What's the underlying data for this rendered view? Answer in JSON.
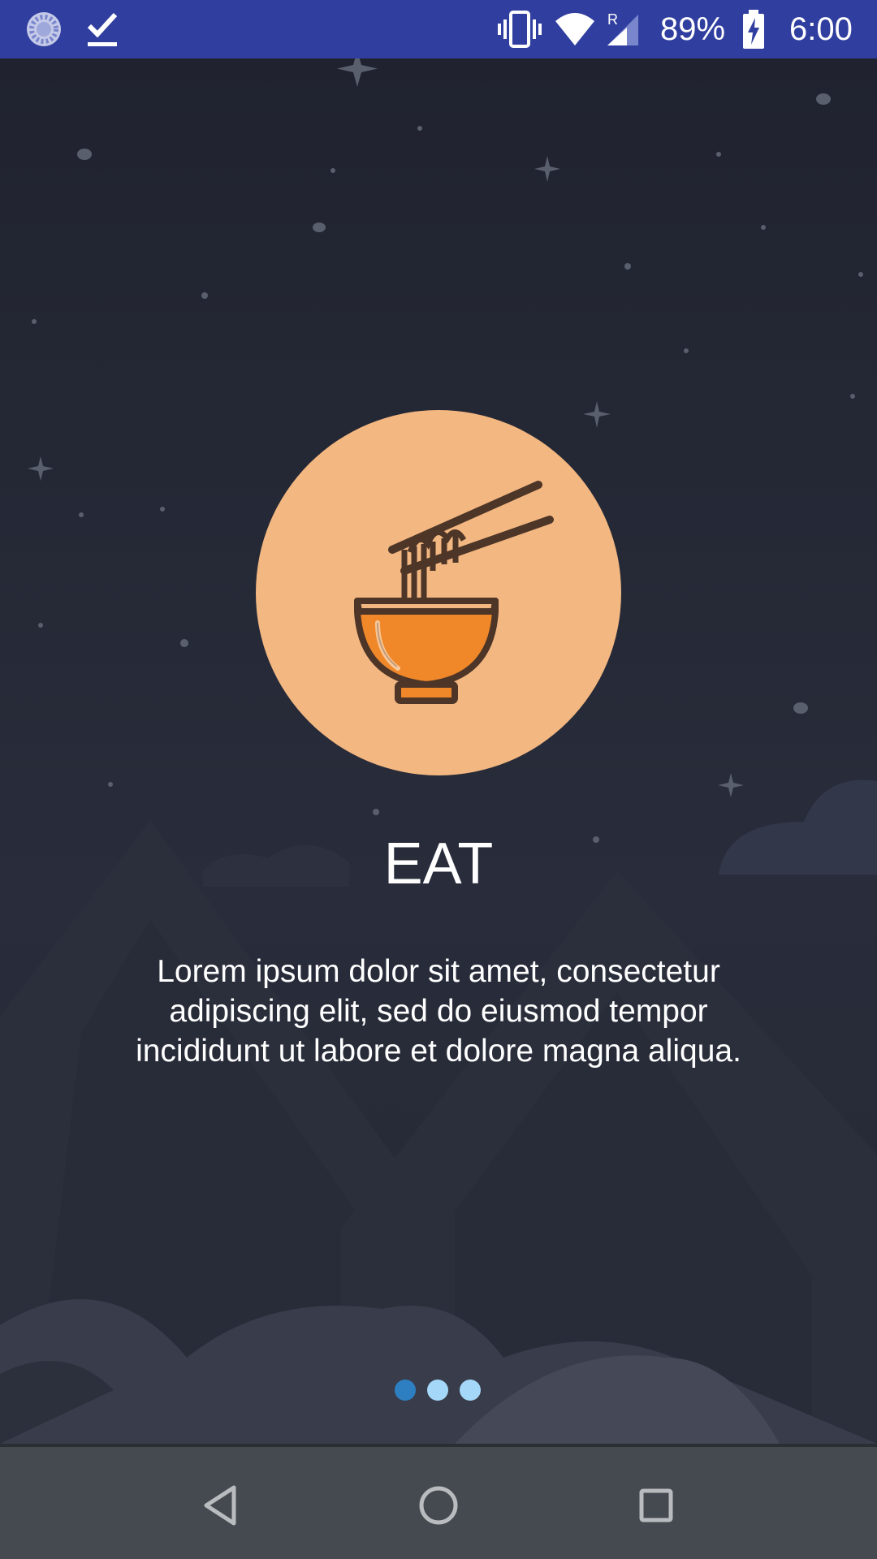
{
  "status_bar": {
    "battery_percent": "89%",
    "time": "6:00",
    "network_roaming_label": "R",
    "icons": [
      "sync-icon",
      "download-complete-icon",
      "vibrate-icon",
      "wifi-icon",
      "cell-signal-icon",
      "battery-charging-icon"
    ],
    "background_color": "#303f9f"
  },
  "slide": {
    "title": "EAT",
    "body": "Lorem ipsum dolor sit amet, consectetur adipiscing elit, sed do eiusmod tempor incididunt ut labore et dolore magna aliqua.",
    "illustration": "noodle-bowl-icon",
    "illustration_background": "#f3b781",
    "accent_color": "#f0882a"
  },
  "pager": {
    "total_pages": 3,
    "current_page": 1,
    "active_color": "#2e7fc2",
    "inactive_color": "#a5d8f8"
  },
  "nav_bar": {
    "buttons": [
      "back-button",
      "home-button",
      "recents-button"
    ]
  }
}
